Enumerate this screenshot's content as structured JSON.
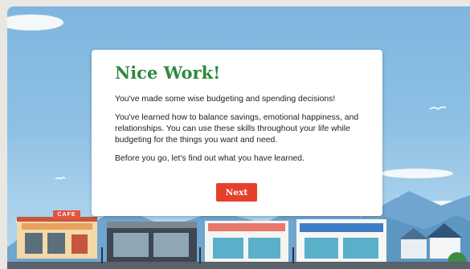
{
  "dialog": {
    "title": "Nice Work!",
    "paragraphs": [
      "You've made some wise budgeting and spending decisions!",
      "You've learned how to balance savings, emotional happiness, and relationships. You can use these skills throughout your life while budgeting for the things you want and need.",
      "Before you go, let's find out what you have learned."
    ],
    "next_label": "Next"
  },
  "scene": {
    "cafe_sign": "CAFE"
  },
  "colors": {
    "title": "#2f8a3e",
    "button": "#e5402b",
    "sky": "#8ec0e4"
  }
}
